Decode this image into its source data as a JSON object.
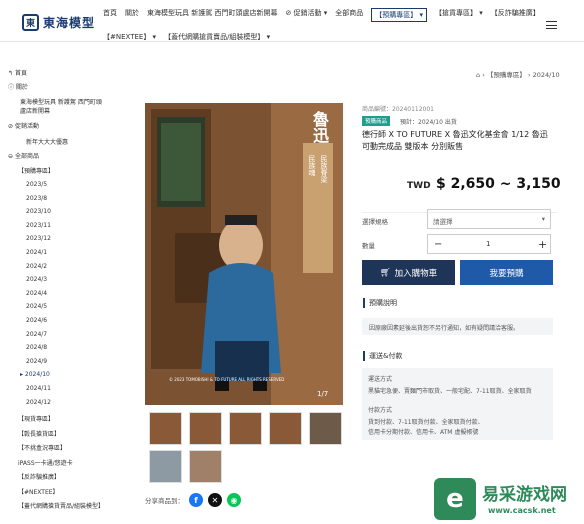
{
  "header": {
    "logo_mark": "東",
    "logo_text": "東海模型",
    "nav": [
      "首頁",
      "關於",
      "東海模型玩具 新護駕 西門町頭盧店新開幕",
      "促銷活動",
      "全部商品",
      "【預購專區】",
      "【搶貨專區】",
      "【反詐騙推廣】",
      "【#NEXTEE】",
      "【蓋代網購搶貨賣品/組裝模型】"
    ],
    "menu_icon": "hamburger-icon"
  },
  "breadcrumb": {
    "home_icon": "home-icon",
    "items": [
      "【預購專區】",
      "2024/10"
    ]
  },
  "sidebar": {
    "back": "首頁",
    "about": "關於",
    "store_news": [
      "東海模型玩具 新護駕 西門町頭",
      "盧店新開幕"
    ],
    "promo": "促銷活動",
    "promo_sub": "新年大大大優惠",
    "all_products": "全部商品",
    "preorder": "【預購專區】",
    "months": [
      "2023/5",
      "2023/8",
      "2023/10",
      "2023/11",
      "2023/12",
      "2024/1",
      "2024/2",
      "2024/3",
      "2024/4",
      "2024/5",
      "2024/6",
      "2024/7",
      "2024/8",
      "2024/9",
      "2024/10",
      "2024/11",
      "2024/12"
    ],
    "sections": [
      "【現貨專區】",
      "【穀長搶貨區】",
      "【不挑盒況專區】",
      "iPASS一卡通/悠遊卡",
      "【反詐騙推廣】",
      "【#NEXTEE】",
      "【蓋代網購搶貨賣品/組裝模型】"
    ]
  },
  "product": {
    "code": "商品編號：20240112001",
    "badge": "預購商品",
    "eta": "預計：2024/10 出貨",
    "title": "德行師 X TO FUTURE X 魯迅文化基金會 1/12 魯迅 可動完成品 雙版本 分別販售",
    "currency": "TWD",
    "price": "$ 2,650 ~ 3,150",
    "spec_label": "選擇規格",
    "spec_value": "請選擇",
    "qty_label": "數量",
    "qty_value": "1",
    "minus": "−",
    "plus": "+",
    "cart_btn": "加入購物車",
    "preorder_btn": "我要預購",
    "preorder_title": "預購說明",
    "preorder_text": "因原廠因素延後出貨恕不另行通知，如有疑問請洽客服。",
    "ship_title": "運送&付款",
    "ship_h1": "運送方式",
    "ship_t1": "黑貓宅急便、賣麵門市取貨、一般宅配、7-11取貨、全家取貨",
    "pay_h": "付款方式",
    "pay_t1": "貨到付款、7-11取貨付款、全家取貨付款、",
    "pay_t2": "信用卡分期付款、信用卡、ATM 虛擬帳號"
  },
  "gallery": {
    "counter": "1/7",
    "caption": "© 2023   TOMOBISHI & TO FUTURE ALL RIGHTS RESERVED",
    "poster_title": "魯迅",
    "poster_sub1": "民族魂",
    "poster_sub2": "民族脊梁"
  },
  "share": {
    "label": "分享商品到：",
    "icons": [
      "facebook-icon",
      "x-icon",
      "line-icon"
    ]
  },
  "watermark": {
    "title": "易采游戏网",
    "url": "www.cacsk.net",
    "mark": "e"
  },
  "colors": {
    "brand": "#1a3b6e",
    "button_dark": "#1e3558",
    "button_blue": "#1e5aa8",
    "badge": "#1f9e8e",
    "wm_green": "#2f8a5a"
  }
}
